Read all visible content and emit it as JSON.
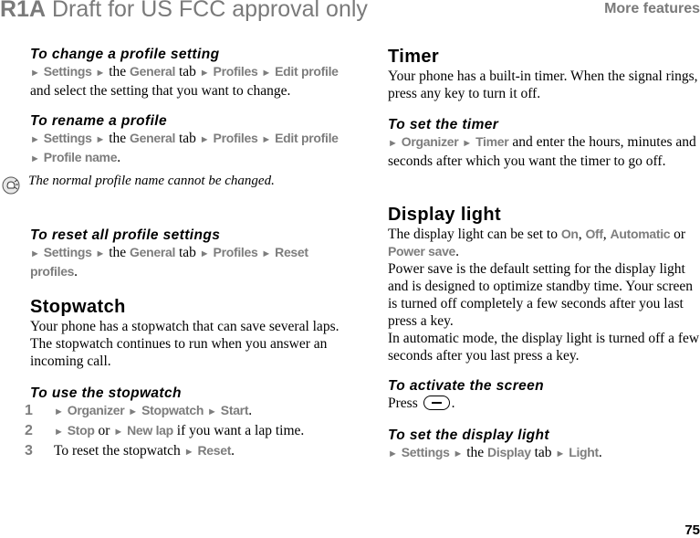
{
  "header": {
    "draft_code": "R1A",
    "draft_text": " Draft for US FCC approval only",
    "section": "More features"
  },
  "page_number": "75",
  "left": {
    "change_profile": {
      "heading": "To change a profile setting",
      "nav": [
        "Settings",
        "General",
        "Profiles",
        "Edit profile"
      ],
      "the": "the",
      "tab": "tab",
      "tail": "and select the setting that you want to change."
    },
    "rename_profile": {
      "heading": "To rename a profile",
      "nav": [
        "Settings",
        "General",
        "Profiles",
        "Edit profile",
        "Profile name"
      ],
      "the": "the",
      "tab": "tab",
      "period": "."
    },
    "note": {
      "icon": "tip-lightbulb-icon",
      "text": "The normal profile name cannot be changed."
    },
    "reset_profiles": {
      "heading": "To reset all profile settings",
      "nav": [
        "Settings",
        "General",
        "Profiles",
        "Reset",
        "profiles"
      ],
      "the": "the",
      "tab": "tab",
      "period": "."
    },
    "stopwatch": {
      "heading": "Stopwatch",
      "body": "Your phone has a stopwatch that can save several laps. The stopwatch continues to run when you answer an incoming call."
    },
    "use_stopwatch": {
      "heading": "To use the stopwatch",
      "steps": [
        {
          "num": "1",
          "nav": [
            "Organizer",
            "Stopwatch",
            "Start"
          ],
          "tail": "."
        },
        {
          "num": "2",
          "nav": [
            "Stop",
            "New lap"
          ],
          "or": "or",
          "tail": "if you want a lap time."
        },
        {
          "num": "3",
          "prefix": "To reset the stopwatch",
          "nav": [
            "Reset"
          ],
          "tail": "."
        }
      ]
    }
  },
  "right": {
    "timer": {
      "heading": "Timer",
      "body": "Your phone has a built-in timer. When the signal rings, press any key to turn it off."
    },
    "set_timer": {
      "heading": "To set the timer",
      "nav": [
        "Organizer",
        "Timer"
      ],
      "tail": "and enter the hours, minutes and seconds after which you want the timer to go off."
    },
    "display_light": {
      "heading": "Display light",
      "intro": "The display light can be set to",
      "options": [
        "On",
        "Off",
        "Automatic",
        "Power save"
      ],
      "or": "or",
      "p2": "Power save is the default setting for the display light and is designed to optimize standby time. Your screen is turned off completely a few seconds after you last press a key.",
      "p3": "In automatic mode, the display light is turned off a few seconds after you last press a key."
    },
    "activate_screen": {
      "heading": "To activate the screen",
      "press": "Press",
      "key_icon": "minus-key-icon",
      "period": "."
    },
    "set_display_light": {
      "heading": "To set the display light",
      "nav": [
        "Settings",
        "Display",
        "Light"
      ],
      "the": "the",
      "tab": "tab",
      "period": "."
    }
  }
}
